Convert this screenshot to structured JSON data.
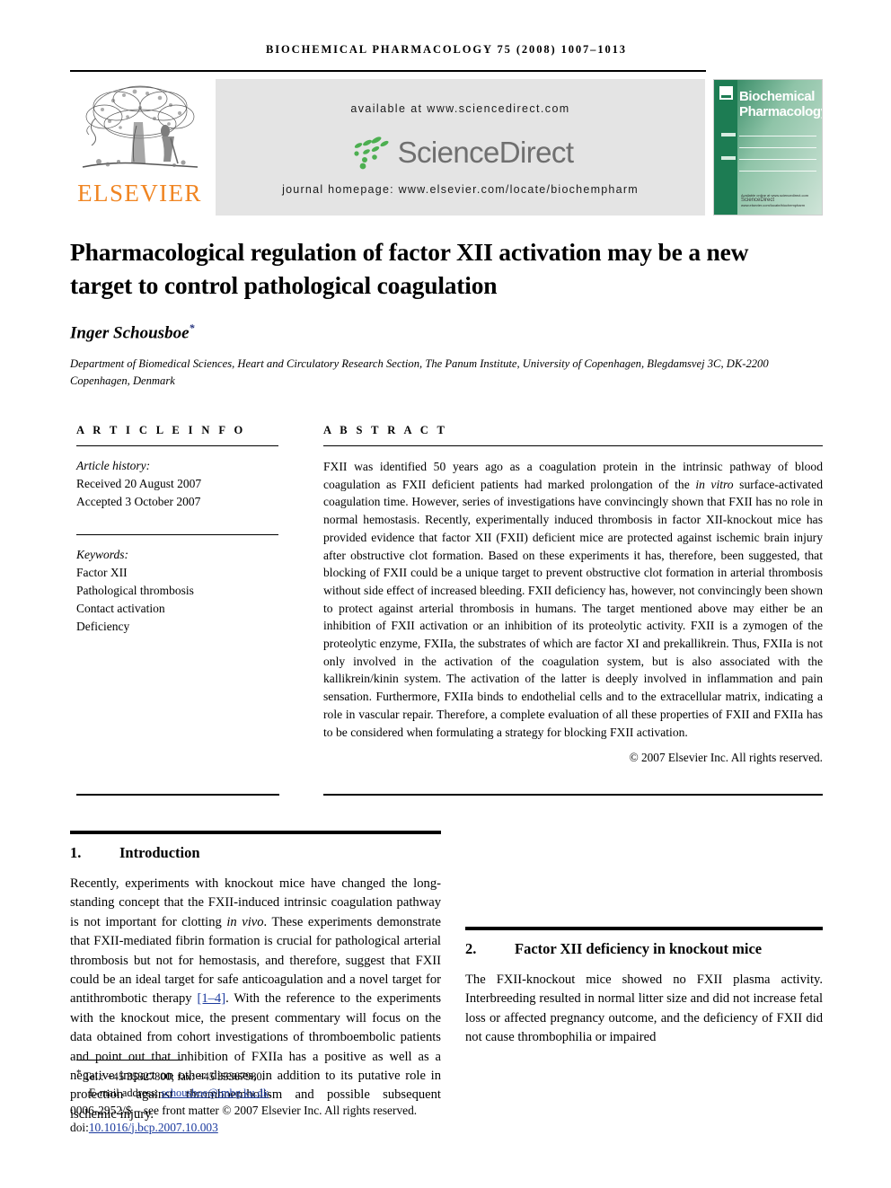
{
  "running_head": "Biochemical Pharmacology 75 (2008) 1007–1013",
  "masthead": {
    "publisher_name": "ELSEVIER",
    "available_at": "available at www.sciencedirect.com",
    "sciencedirect_wordmark": "ScienceDirect",
    "journal_homepage": "journal homepage: www.elsevier.com/locate/biochempharm",
    "cover": {
      "journal_title_line1": "Biochemical",
      "journal_title_line2": "Pharmacology",
      "cover_footer_text": "Available online at www.sciencedirect.com",
      "cover_footer_brand": "ScienceDirect",
      "cover_footer_url": "www.elsevier.com/locate/biochempharm"
    }
  },
  "article": {
    "title": "Pharmacological regulation of factor XII activation may be a new target to control pathological coagulation",
    "author": "Inger Schousboe",
    "author_marker": "*",
    "affiliation": "Department of Biomedical Sciences, Heart and Circulatory Research Section, The Panum Institute, University of Copenhagen, Blegdamsvej 3C, DK-2200 Copenhagen, Denmark"
  },
  "article_info": {
    "heading": "A R T I C L E   I N F O",
    "history_label": "Article history:",
    "received": "Received 20 August 2007",
    "accepted": "Accepted 3 October 2007",
    "keywords_label": "Keywords:",
    "keywords": [
      "Factor XII",
      "Pathological thrombosis",
      "Contact activation",
      "Deficiency"
    ]
  },
  "abstract": {
    "heading": "A B S T R A C T",
    "part1": "FXII was identified 50 years ago as a coagulation protein in the intrinsic pathway of blood coagulation as FXII deficient patients had marked prolongation of the ",
    "italic1": "in vitro",
    "part2": " surface-activated coagulation time. However, series of investigations have convincingly shown that FXII has no role in normal hemostasis. Recently, experimentally induced thrombosis in factor XII-knockout mice has provided evidence that factor XII (FXII) deficient mice are protected against ischemic brain injury after obstructive clot formation. Based on these experiments it has, therefore, been suggested, that blocking of FXII could be a unique target to prevent obstructive clot formation in arterial thrombosis without side effect of increased bleeding. FXII deficiency has, however, not convincingly been shown to protect against arterial thrombosis in humans. The target mentioned above may either be an inhibition of FXII activation or an inhibition of its proteolytic activity. FXII is a zymogen of the proteolytic enzyme, FXIIa, the substrates of which are factor XI and prekallikrein. Thus, FXIIa is not only involved in the activation of the coagulation system, but is also associated with the kallikrein/kinin system. The activation of the latter is deeply involved in inflammation and pain sensation. Furthermore, FXIIa binds to endothelial cells and to the extracellular matrix, indicating a role in vascular repair. Therefore, a complete evaluation of all these properties of FXII and FXIIa has to be considered when formulating a strategy for blocking FXII activation.",
    "copyright": "© 2007 Elsevier Inc. All rights reserved."
  },
  "sections": {
    "introduction": {
      "number": "1.",
      "title": "Introduction",
      "text_before_ref": "Recently, experiments with knockout mice have changed the long-standing concept that the FXII-induced intrinsic coagulation pathway is not important for clotting ",
      "italic_invivo": "in vivo",
      "text_mid": ". These experiments demonstrate that FXII-mediated fibrin formation is crucial for pathological arterial thrombosis but not for hemostasis, and therefore, suggest that FXII could be an ideal target for safe anticoagulation and a novel target for antithrombotic therapy ",
      "reference_link": "[1–4]",
      "text_after_ref": ". With the reference to the experiments with the knockout mice, the present commentary will focus on the data obtained from cohort investigations of thromboembolic patients and point out that inhibition of FXIIa has a positive as well as a negative impact on other diseases, in addition to its putative role in protection against thromboembolism and possible subsequent ischemic injury."
    },
    "section2": {
      "number": "2.",
      "title": "Factor XII deficiency in knockout mice",
      "text": "The FXII-knockout mice showed no FXII plasma activity. Interbreeding resulted in normal litter size and did not increase fetal loss or affected pregnancy outcome, and the deficiency of FXII did not cause thrombophilia or impaired"
    }
  },
  "footer": {
    "corresponding_marker": "*",
    "tel_fax": "Tel.: +45 35327800; fax: +45 35367980.",
    "email_label": "E-mail address:",
    "email": "schousboe@imbg.ku.dk",
    "email_period": ".",
    "front_matter": "0006-2952/$ – see front matter © 2007 Elsevier Inc. All rights reserved.",
    "doi_label": "doi:",
    "doi": "10.1016/j.bcp.2007.10.003"
  },
  "colors": {
    "elsevier_orange": "#f08522",
    "sciencedirect_green": "#4caf50",
    "sciencedirect_gray": "#6f6f6f",
    "link_blue": "#1b3a9e",
    "cover_green": "#1d7c53",
    "banner_gray": "#e4e4e4"
  }
}
